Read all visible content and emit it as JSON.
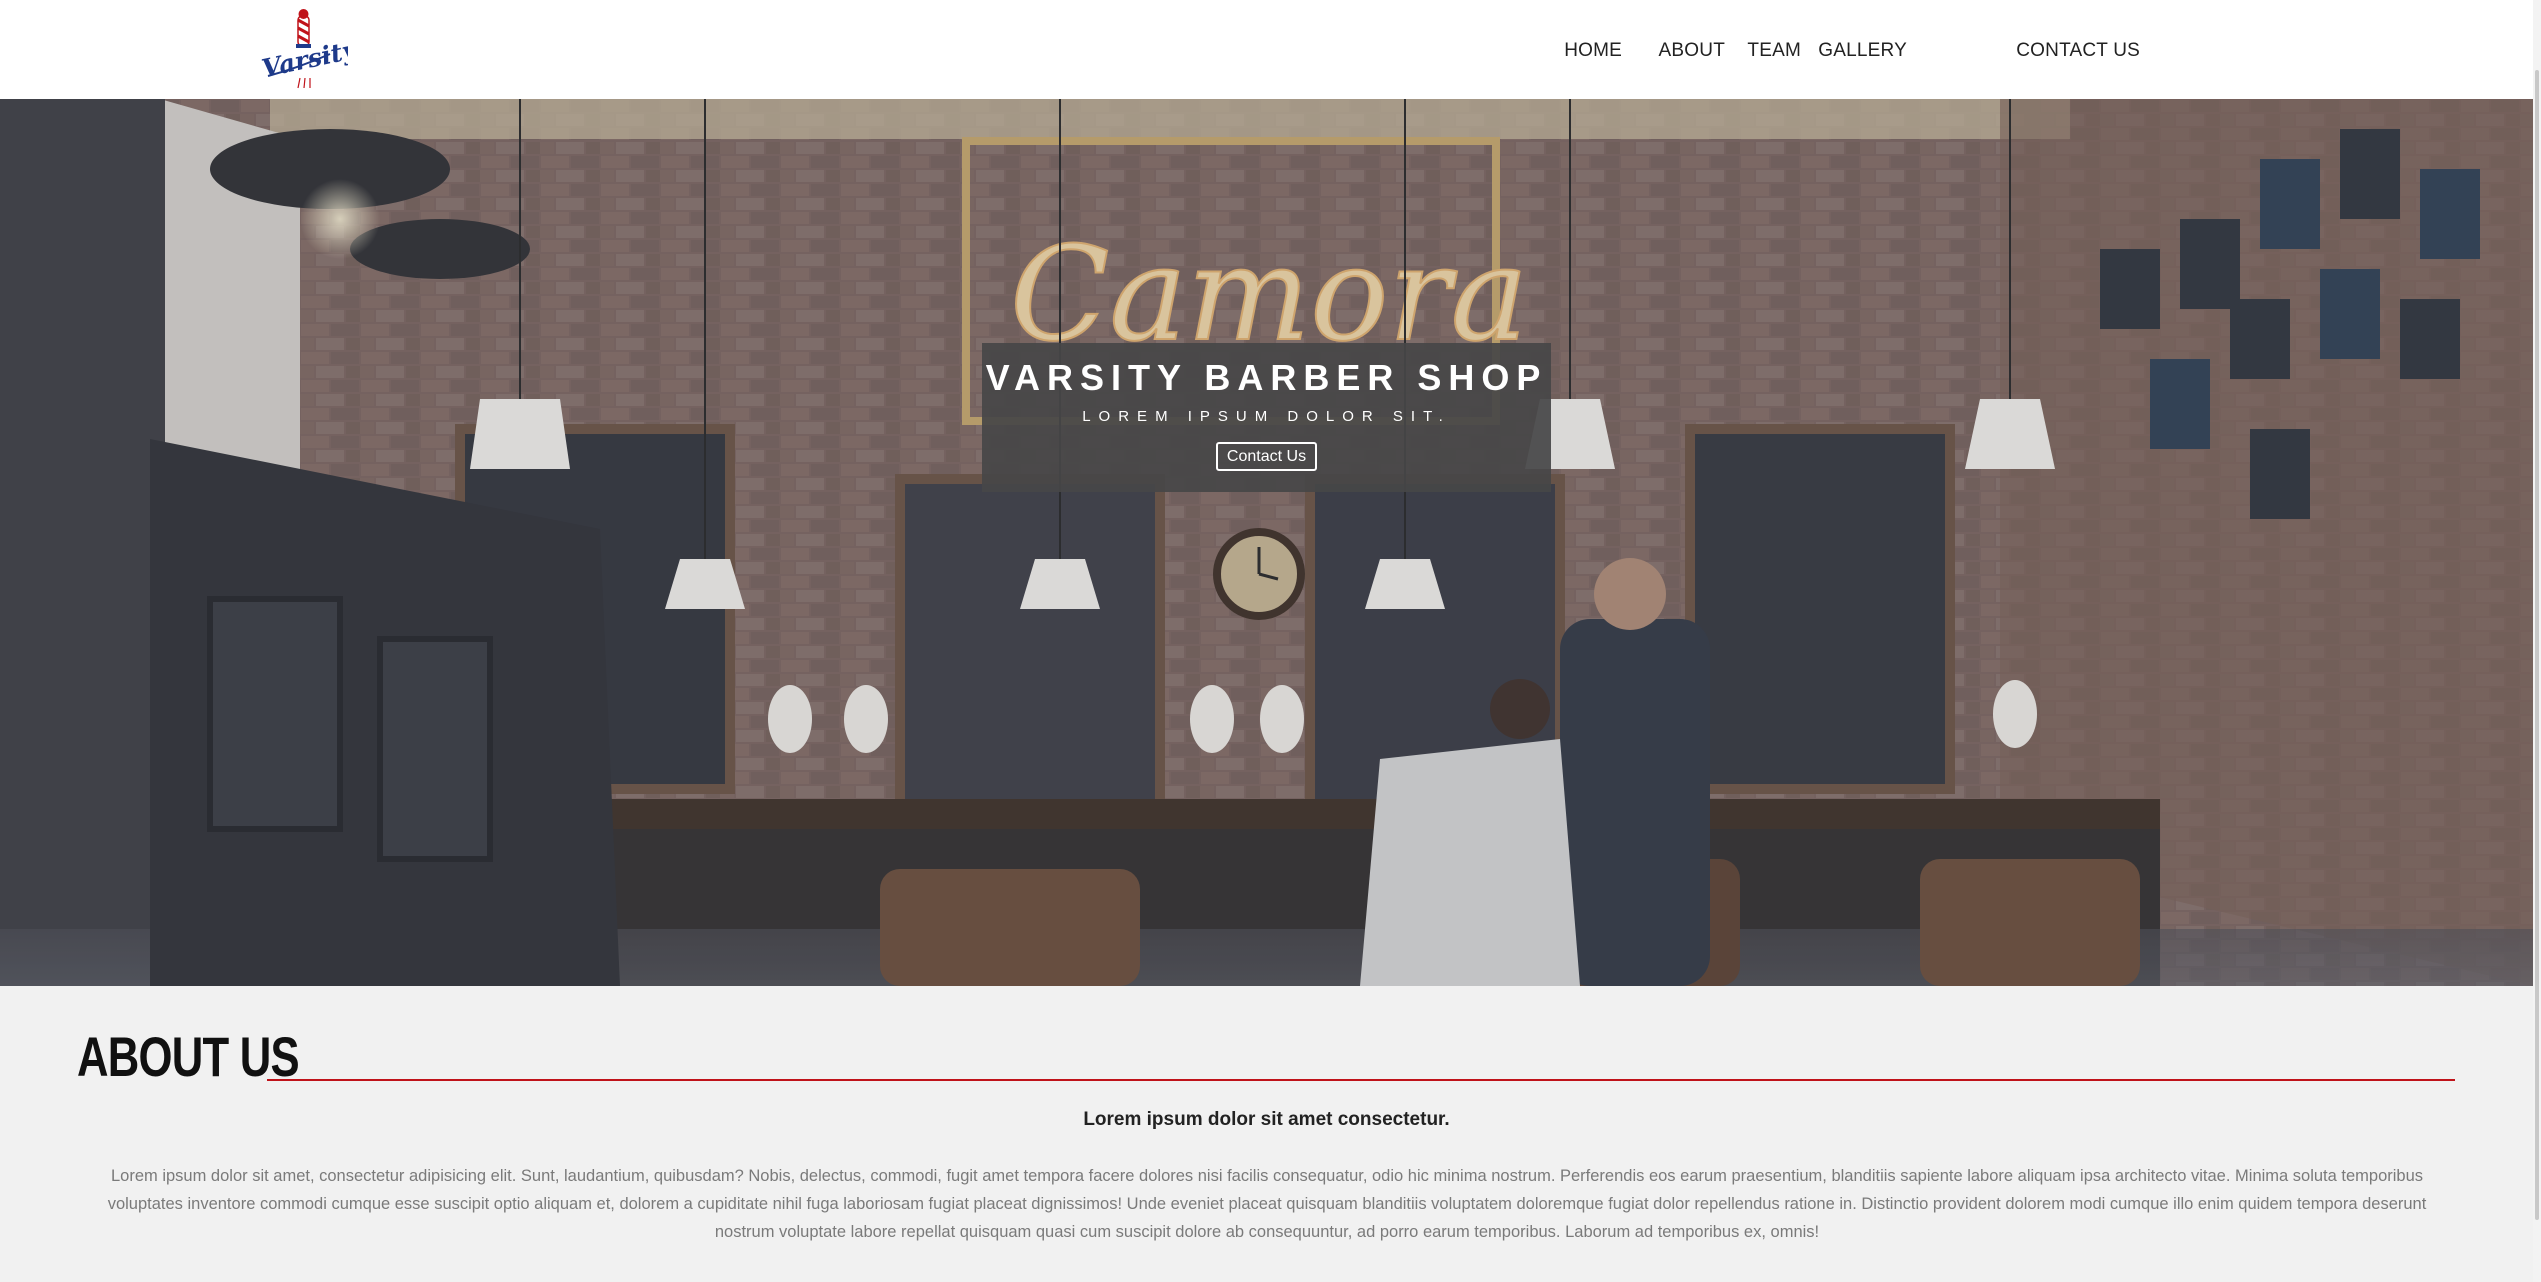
{
  "header": {
    "logo_text": "Varsity",
    "nav": [
      "HOME",
      "ABOUT",
      "TEAM",
      "GALLERY",
      "CONTACT US"
    ]
  },
  "hero": {
    "title": "VARSITY BARBER SHOP",
    "subtitle": "LOREM IPSUM DOLOR SIT.",
    "button_label": "Contact Us",
    "sign_text": "Camora"
  },
  "about": {
    "heading": "ABOUT US",
    "lead": "Lorem ipsum dolor sit amet consectetur.",
    "body": "Lorem ipsum dolor sit amet, consectetur adipisicing elit. Sunt, laudantium, quibusdam? Nobis, delectus, commodi, fugit amet tempora facere dolores nisi facilis consequatur, odio hic minima nostrum. Perferendis eos earum praesentium, blanditiis sapiente labore aliquam ipsa architecto vitae. Minima soluta temporibus voluptates inventore commodi cumque esse suscipit optio aliquam et, dolorem a cupiditate nihil fuga laboriosam fugiat placeat dignissimos! Unde eveniet placeat quisquam blanditiis voluptatem doloremque fugiat dolor repellendus ratione in. Distinctio provident dolorem modi cumque illo enim quidem tempora deserunt nostrum voluptate labore repellat quisquam quasi cum suscipit dolore ab consequuntur, ad porro earum temporibus. Laborum ad temporibus ex, omnis!"
  },
  "colors": {
    "accent_red": "#c0131a",
    "logo_blue": "#1e3a8a",
    "hero_box": "#464648"
  }
}
